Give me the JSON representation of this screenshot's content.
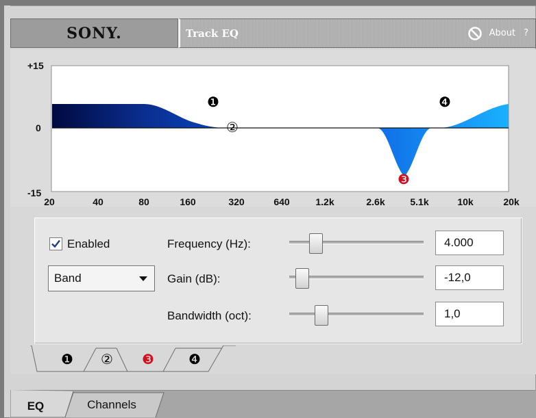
{
  "header": {
    "brand": "SONY.",
    "title": "Track EQ",
    "about": "About",
    "help": "?"
  },
  "graph": {
    "y_labels": [
      "+15",
      "0",
      "-15"
    ],
    "x_labels": [
      "20",
      "40",
      "80",
      "160",
      "320",
      "640",
      "1.2k",
      "2.6k",
      "5.1k",
      "10k",
      "20k"
    ],
    "band_markers": [
      "❶",
      "②",
      "❸",
      "❹"
    ]
  },
  "controls": {
    "enabled_label": "Enabled",
    "enabled_checked": true,
    "filter_type": "Band",
    "frequency_label": "Frequency (Hz):",
    "frequency_value": "4.000",
    "gain_label": "Gain (dB):",
    "gain_value": "-12,0",
    "bandwidth_label": "Bandwidth (oct):",
    "bandwidth_value": "1,0"
  },
  "band_tabs": [
    "❶",
    "②",
    "❸",
    "❹"
  ],
  "bottom_tabs": [
    "EQ",
    "Channels"
  ],
  "colors": {
    "curve_dark": "#000a40",
    "curve_mid": "#0a3fb0",
    "curve_light": "#1ab0ff",
    "band3_marker": "#d0101e"
  }
}
